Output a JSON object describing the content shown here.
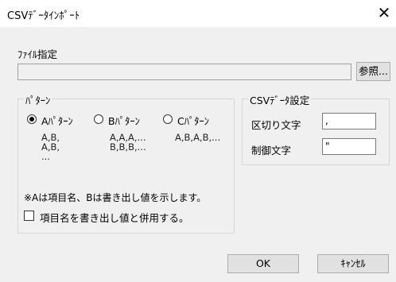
{
  "window": {
    "title": "CSVﾃﾞｰﾀｲﾝﾎﾟｰﾄ",
    "close_glyph": "✕"
  },
  "file": {
    "label": "ﾌｧｲﾙ指定",
    "path_value": "",
    "browse_label": "参照..."
  },
  "pattern_group": {
    "legend": "ﾊﾟﾀｰﾝ",
    "options": [
      {
        "label": "Aﾊﾟﾀｰﾝ",
        "selected": true,
        "example": "A,B,\nA,B,\n..."
      },
      {
        "label": "Bﾊﾟﾀｰﾝ",
        "selected": false,
        "example": "A,A,A,...\nB,B,B,..."
      },
      {
        "label": "Cﾊﾟﾀｰﾝ",
        "selected": false,
        "example": "A,B,A,B,..."
      }
    ],
    "note": "※Aは項目名、Bは書き出し値を示します。",
    "checkbox_label": "項目名を書き出し値と併用する。",
    "checkbox_checked": false
  },
  "csv_group": {
    "legend": "CSVﾃﾞｰﾀ設定",
    "delimiter_label": "区切り文字",
    "delimiter_value": ",",
    "control_label": "制御文字",
    "control_value": "\""
  },
  "buttons": {
    "ok": "OK",
    "cancel": "ｷｬﾝｾﾙ"
  }
}
